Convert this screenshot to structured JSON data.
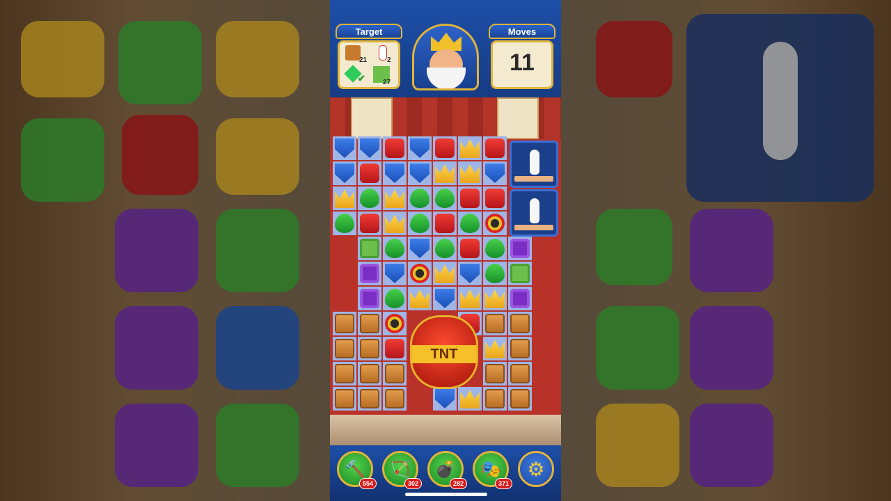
{
  "header": {
    "target_label": "Target",
    "moves_label": "Moves",
    "moves_value": "11"
  },
  "targets": [
    {
      "icon": "crate-icon",
      "count": "21"
    },
    {
      "icon": "bowling-pin-icon",
      "count": "2"
    },
    {
      "icon": "gem-icon",
      "count": "✔"
    },
    {
      "icon": "grass-icon",
      "count": "27"
    }
  ],
  "tnt_label": "TNT",
  "boosters": [
    {
      "icon": "hammer-icon",
      "glyph": "🔨",
      "count": "554"
    },
    {
      "icon": "arrow-icon",
      "glyph": "🏹",
      "count": "302"
    },
    {
      "icon": "cannon-icon",
      "glyph": "💣",
      "count": "282"
    },
    {
      "icon": "jester-hat-icon",
      "glyph": "🎭",
      "count": "371"
    }
  ],
  "settings_glyph": "⚙",
  "colors": {
    "panel_gold": "#e2b43a",
    "bar_blue": "#1d4fa8"
  }
}
